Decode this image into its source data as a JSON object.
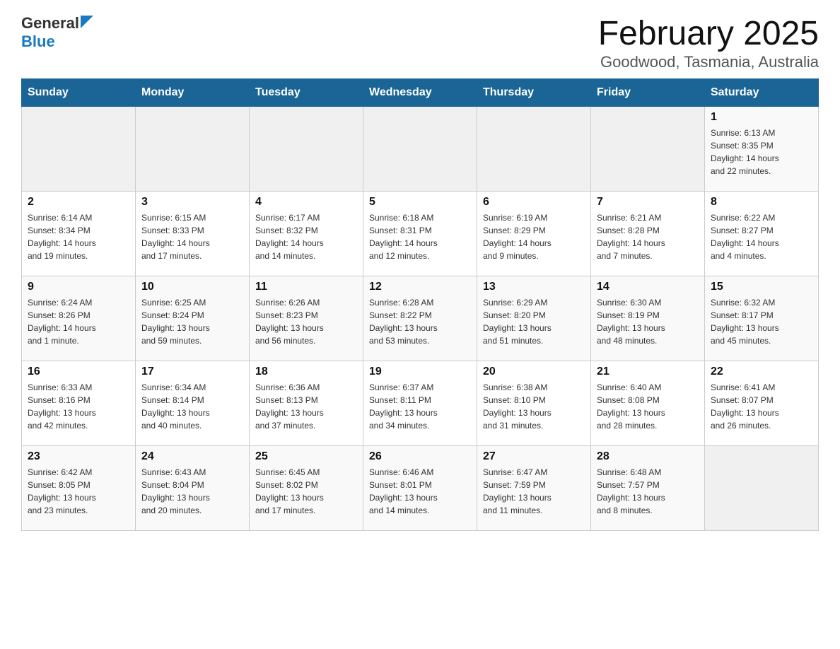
{
  "header": {
    "logo_general": "General",
    "logo_blue": "Blue",
    "title": "February 2025",
    "subtitle": "Goodwood, Tasmania, Australia"
  },
  "calendar": {
    "days_of_week": [
      "Sunday",
      "Monday",
      "Tuesday",
      "Wednesday",
      "Thursday",
      "Friday",
      "Saturday"
    ],
    "weeks": [
      [
        {
          "day": "",
          "info": ""
        },
        {
          "day": "",
          "info": ""
        },
        {
          "day": "",
          "info": ""
        },
        {
          "day": "",
          "info": ""
        },
        {
          "day": "",
          "info": ""
        },
        {
          "day": "",
          "info": ""
        },
        {
          "day": "1",
          "info": "Sunrise: 6:13 AM\nSunset: 8:35 PM\nDaylight: 14 hours\nand 22 minutes."
        }
      ],
      [
        {
          "day": "2",
          "info": "Sunrise: 6:14 AM\nSunset: 8:34 PM\nDaylight: 14 hours\nand 19 minutes."
        },
        {
          "day": "3",
          "info": "Sunrise: 6:15 AM\nSunset: 8:33 PM\nDaylight: 14 hours\nand 17 minutes."
        },
        {
          "day": "4",
          "info": "Sunrise: 6:17 AM\nSunset: 8:32 PM\nDaylight: 14 hours\nand 14 minutes."
        },
        {
          "day": "5",
          "info": "Sunrise: 6:18 AM\nSunset: 8:31 PM\nDaylight: 14 hours\nand 12 minutes."
        },
        {
          "day": "6",
          "info": "Sunrise: 6:19 AM\nSunset: 8:29 PM\nDaylight: 14 hours\nand 9 minutes."
        },
        {
          "day": "7",
          "info": "Sunrise: 6:21 AM\nSunset: 8:28 PM\nDaylight: 14 hours\nand 7 minutes."
        },
        {
          "day": "8",
          "info": "Sunrise: 6:22 AM\nSunset: 8:27 PM\nDaylight: 14 hours\nand 4 minutes."
        }
      ],
      [
        {
          "day": "9",
          "info": "Sunrise: 6:24 AM\nSunset: 8:26 PM\nDaylight: 14 hours\nand 1 minute."
        },
        {
          "day": "10",
          "info": "Sunrise: 6:25 AM\nSunset: 8:24 PM\nDaylight: 13 hours\nand 59 minutes."
        },
        {
          "day": "11",
          "info": "Sunrise: 6:26 AM\nSunset: 8:23 PM\nDaylight: 13 hours\nand 56 minutes."
        },
        {
          "day": "12",
          "info": "Sunrise: 6:28 AM\nSunset: 8:22 PM\nDaylight: 13 hours\nand 53 minutes."
        },
        {
          "day": "13",
          "info": "Sunrise: 6:29 AM\nSunset: 8:20 PM\nDaylight: 13 hours\nand 51 minutes."
        },
        {
          "day": "14",
          "info": "Sunrise: 6:30 AM\nSunset: 8:19 PM\nDaylight: 13 hours\nand 48 minutes."
        },
        {
          "day": "15",
          "info": "Sunrise: 6:32 AM\nSunset: 8:17 PM\nDaylight: 13 hours\nand 45 minutes."
        }
      ],
      [
        {
          "day": "16",
          "info": "Sunrise: 6:33 AM\nSunset: 8:16 PM\nDaylight: 13 hours\nand 42 minutes."
        },
        {
          "day": "17",
          "info": "Sunrise: 6:34 AM\nSunset: 8:14 PM\nDaylight: 13 hours\nand 40 minutes."
        },
        {
          "day": "18",
          "info": "Sunrise: 6:36 AM\nSunset: 8:13 PM\nDaylight: 13 hours\nand 37 minutes."
        },
        {
          "day": "19",
          "info": "Sunrise: 6:37 AM\nSunset: 8:11 PM\nDaylight: 13 hours\nand 34 minutes."
        },
        {
          "day": "20",
          "info": "Sunrise: 6:38 AM\nSunset: 8:10 PM\nDaylight: 13 hours\nand 31 minutes."
        },
        {
          "day": "21",
          "info": "Sunrise: 6:40 AM\nSunset: 8:08 PM\nDaylight: 13 hours\nand 28 minutes."
        },
        {
          "day": "22",
          "info": "Sunrise: 6:41 AM\nSunset: 8:07 PM\nDaylight: 13 hours\nand 26 minutes."
        }
      ],
      [
        {
          "day": "23",
          "info": "Sunrise: 6:42 AM\nSunset: 8:05 PM\nDaylight: 13 hours\nand 23 minutes."
        },
        {
          "day": "24",
          "info": "Sunrise: 6:43 AM\nSunset: 8:04 PM\nDaylight: 13 hours\nand 20 minutes."
        },
        {
          "day": "25",
          "info": "Sunrise: 6:45 AM\nSunset: 8:02 PM\nDaylight: 13 hours\nand 17 minutes."
        },
        {
          "day": "26",
          "info": "Sunrise: 6:46 AM\nSunset: 8:01 PM\nDaylight: 13 hours\nand 14 minutes."
        },
        {
          "day": "27",
          "info": "Sunrise: 6:47 AM\nSunset: 7:59 PM\nDaylight: 13 hours\nand 11 minutes."
        },
        {
          "day": "28",
          "info": "Sunrise: 6:48 AM\nSunset: 7:57 PM\nDaylight: 13 hours\nand 8 minutes."
        },
        {
          "day": "",
          "info": ""
        }
      ]
    ]
  }
}
